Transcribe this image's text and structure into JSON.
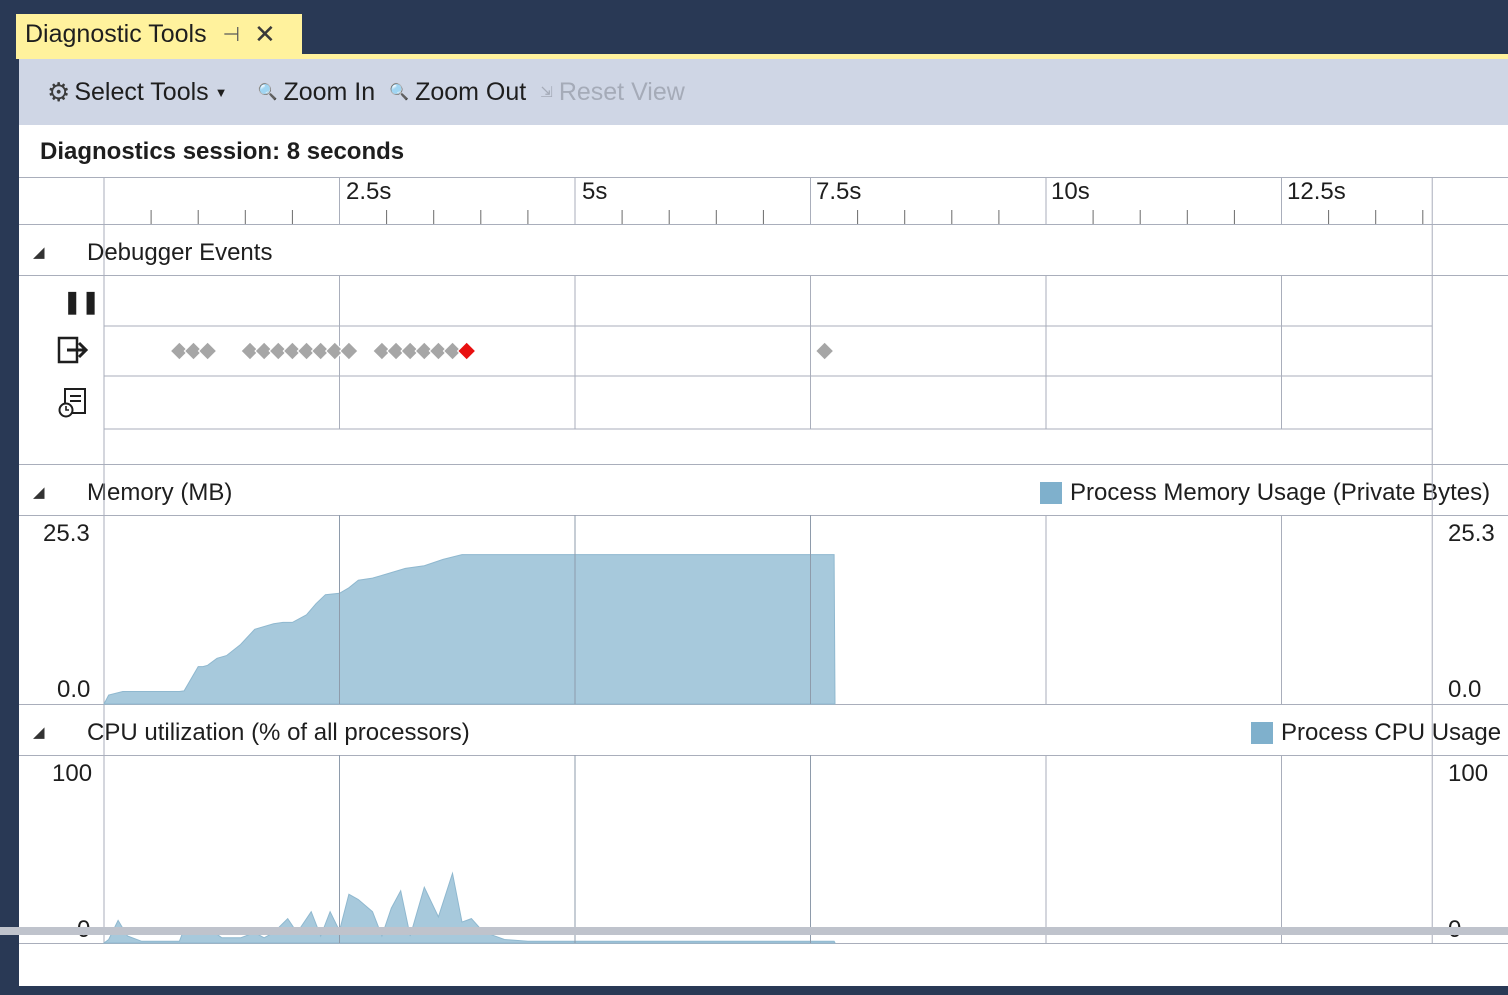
{
  "tab": {
    "title": "Diagnostic Tools",
    "pin_icon": "⊣",
    "close_icon": "✕"
  },
  "toolbar": {
    "select_tools": "Select Tools",
    "zoom_in": "Zoom In",
    "zoom_out": "Zoom Out",
    "reset_view": "Reset View"
  },
  "session": {
    "label": "Diagnostics session: 8 seconds"
  },
  "ruler": {
    "ticks": [
      "2.5s",
      "5s",
      "7.5s",
      "10s",
      "12.5s"
    ]
  },
  "debugger": {
    "title": "Debugger Events",
    "rows": [
      "break-icon",
      "step-icon",
      "intellitrace-icon"
    ]
  },
  "memory": {
    "title": "Memory (MB)",
    "legend": "Process Memory Usage (Private Bytes)",
    "ymax": "25.3",
    "ymin": "0.0"
  },
  "cpu": {
    "title": "CPU utilization (% of all processors)",
    "legend": "Process CPU Usage",
    "ymax": "100",
    "ymin": "0"
  },
  "colors": {
    "accent": "#293955",
    "tab": "#fff29d",
    "toolbar": "#cfd6e5",
    "series": "#a7c9dc",
    "legend_swatch": "#7fb0cc",
    "break_event": "#e81010",
    "event": "#a6a6a6"
  },
  "chart_data": [
    {
      "type": "scatter",
      "title": "Debugger Events",
      "x_unit": "s",
      "xlim": [
        0,
        14.1
      ],
      "series": [
        {
          "values": [
            [
              0.8,
              1
            ],
            [
              0.95,
              1
            ],
            [
              1.1,
              1
            ],
            [
              1.55,
              1
            ],
            [
              1.7,
              1
            ],
            [
              1.85,
              1
            ],
            [
              2.0,
              1
            ],
            [
              2.15,
              1
            ],
            [
              2.3,
              1
            ],
            [
              2.45,
              1
            ],
            [
              2.6,
              1
            ],
            [
              2.95,
              1
            ],
            [
              3.1,
              1
            ],
            [
              3.25,
              1
            ],
            [
              3.4,
              1
            ],
            [
              3.55,
              1
            ],
            [
              3.7,
              1
            ],
            [
              7.65,
              1
            ]
          ]
        },
        {
          "values": [
            [
              3.85,
              1
            ]
          ]
        }
      ]
    },
    {
      "type": "area",
      "title": "Memory (MB)",
      "legend": [
        "Process Memory Usage (Private Bytes)"
      ],
      "x_unit": "s",
      "xlim": [
        0,
        14.1
      ],
      "ylim": [
        0,
        25.3
      ],
      "x": [
        0,
        0.05,
        0.2,
        0.8,
        0.85,
        1.0,
        1.05,
        1.1,
        1.2,
        1.3,
        1.45,
        1.6,
        1.8,
        1.9,
        2.0,
        2.15,
        2.25,
        2.35,
        2.5,
        2.6,
        2.7,
        2.85,
        3.0,
        3.2,
        3.4,
        3.6,
        3.8,
        4.0,
        5.0,
        6.0,
        7.0,
        7.75,
        7.76
      ],
      "values": [
        0,
        1.3,
        1.8,
        1.8,
        1.9,
        5.4,
        5.4,
        5.6,
        6.6,
        7.0,
        8.6,
        10.8,
        11.6,
        11.8,
        11.8,
        12.9,
        14.5,
        15.8,
        16.0,
        16.8,
        17.9,
        18.2,
        18.8,
        19.6,
        20.0,
        20.9,
        21.6,
        21.6,
        21.6,
        21.6,
        21.6,
        21.6,
        0
      ]
    },
    {
      "type": "area",
      "title": "CPU utilization (% of all processors)",
      "legend": [
        "Process CPU Usage"
      ],
      "x_unit": "s",
      "xlim": [
        0,
        14.1
      ],
      "ylim": [
        0,
        100
      ],
      "x": [
        0,
        0.05,
        0.15,
        0.25,
        0.4,
        0.8,
        0.85,
        0.95,
        1.05,
        1.15,
        1.25,
        1.35,
        1.45,
        1.6,
        1.7,
        1.8,
        1.95,
        2.05,
        2.2,
        2.3,
        2.4,
        2.5,
        2.6,
        2.7,
        2.85,
        2.95,
        3.05,
        3.15,
        3.25,
        3.4,
        3.55,
        3.7,
        3.8,
        3.9,
        4.0,
        4.1,
        4.25,
        4.5,
        5.0,
        6.0,
        7.0,
        7.75,
        7.76
      ],
      "values": [
        0,
        2,
        13,
        4,
        1,
        1,
        8,
        7,
        5,
        7,
        3,
        3,
        3,
        6,
        3,
        6,
        14,
        6,
        18,
        4,
        18,
        7,
        28,
        25,
        18,
        4,
        20,
        30,
        4,
        32,
        15,
        40,
        12,
        14,
        8,
        5,
        2,
        1,
        1,
        1,
        1,
        1,
        0
      ]
    }
  ]
}
